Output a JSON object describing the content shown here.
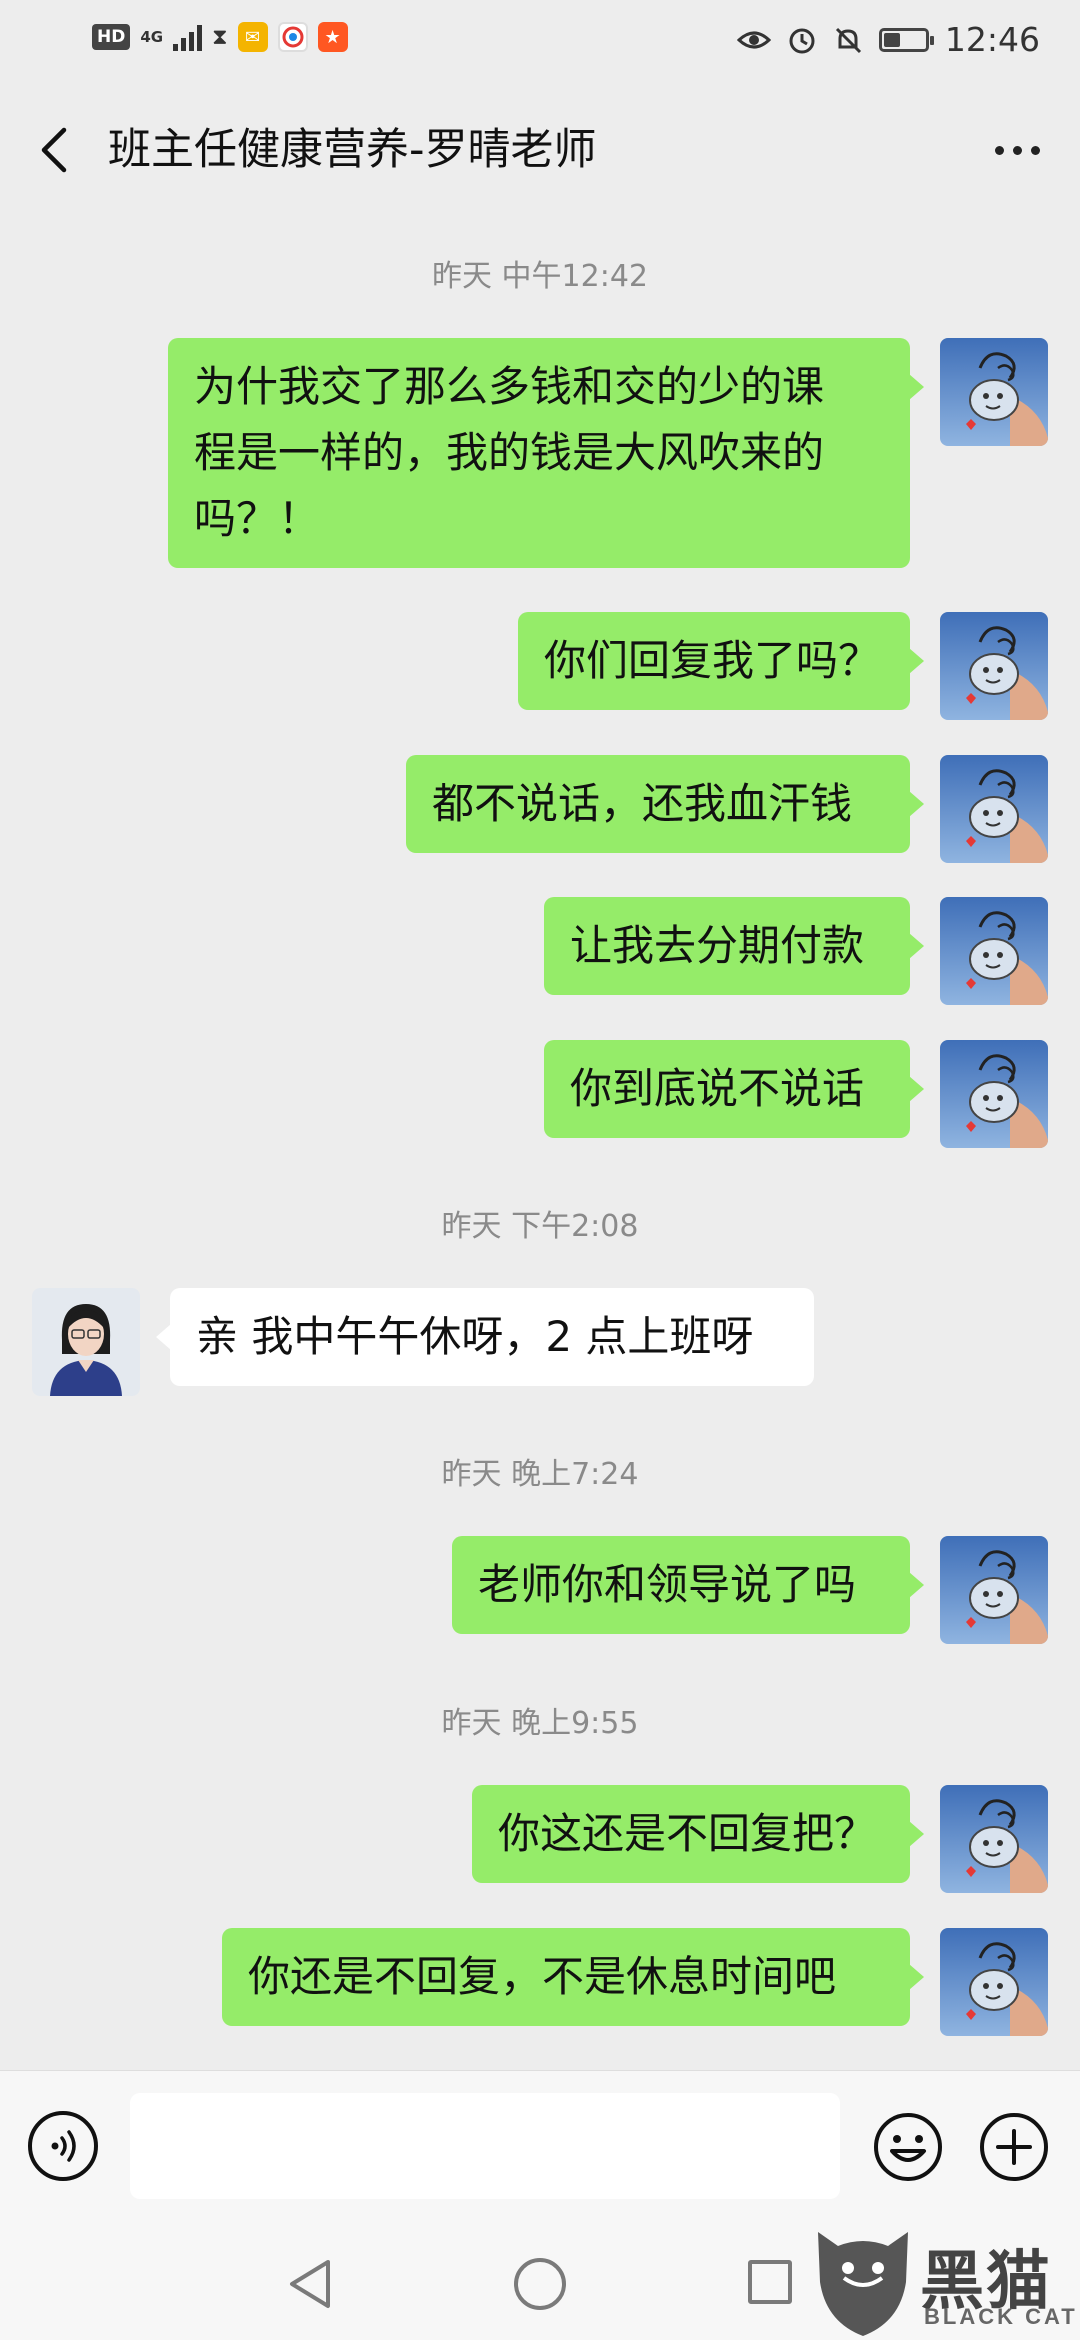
{
  "status_bar": {
    "hd": "HD",
    "network": "4G",
    "time": "12:46",
    "battery_level": 0.4
  },
  "header": {
    "title": "班主任健康营养-罗晴老师"
  },
  "chat": {
    "timestamps": [
      "昨天 中午12:42",
      "昨天 下午2:08",
      "昨天 晚上7:24",
      "昨天 晚上9:55"
    ],
    "messages": [
      {
        "sender": "me",
        "lines": [
          "为什我交了那么多钱和交的少的课",
          "程是一样的，我的钱是大风吹来的",
          "吗？！"
        ]
      },
      {
        "sender": "me",
        "lines": [
          "你们回复我了吗？"
        ]
      },
      {
        "sender": "me",
        "lines": [
          "都不说话，还我血汗钱"
        ]
      },
      {
        "sender": "me",
        "lines": [
          "让我去分期付款"
        ]
      },
      {
        "sender": "me",
        "lines": [
          "你到底说不说话"
        ]
      },
      {
        "sender": "them",
        "lines": [
          "亲 我中午午休呀，2 点上班呀"
        ]
      },
      {
        "sender": "me",
        "lines": [
          "老师你和领导说了吗"
        ]
      },
      {
        "sender": "me",
        "lines": [
          "你这还是不回复把？"
        ]
      },
      {
        "sender": "me",
        "lines": [
          "你还是不回复，不是休息时间吧"
        ]
      }
    ]
  },
  "input": {
    "value": ""
  },
  "watermark": {
    "cn": "黑猫",
    "en": "BLACK CAT"
  },
  "colors": {
    "background": "#ededed",
    "my_bubble": "#95ec69",
    "their_bubble": "#ffffff"
  }
}
